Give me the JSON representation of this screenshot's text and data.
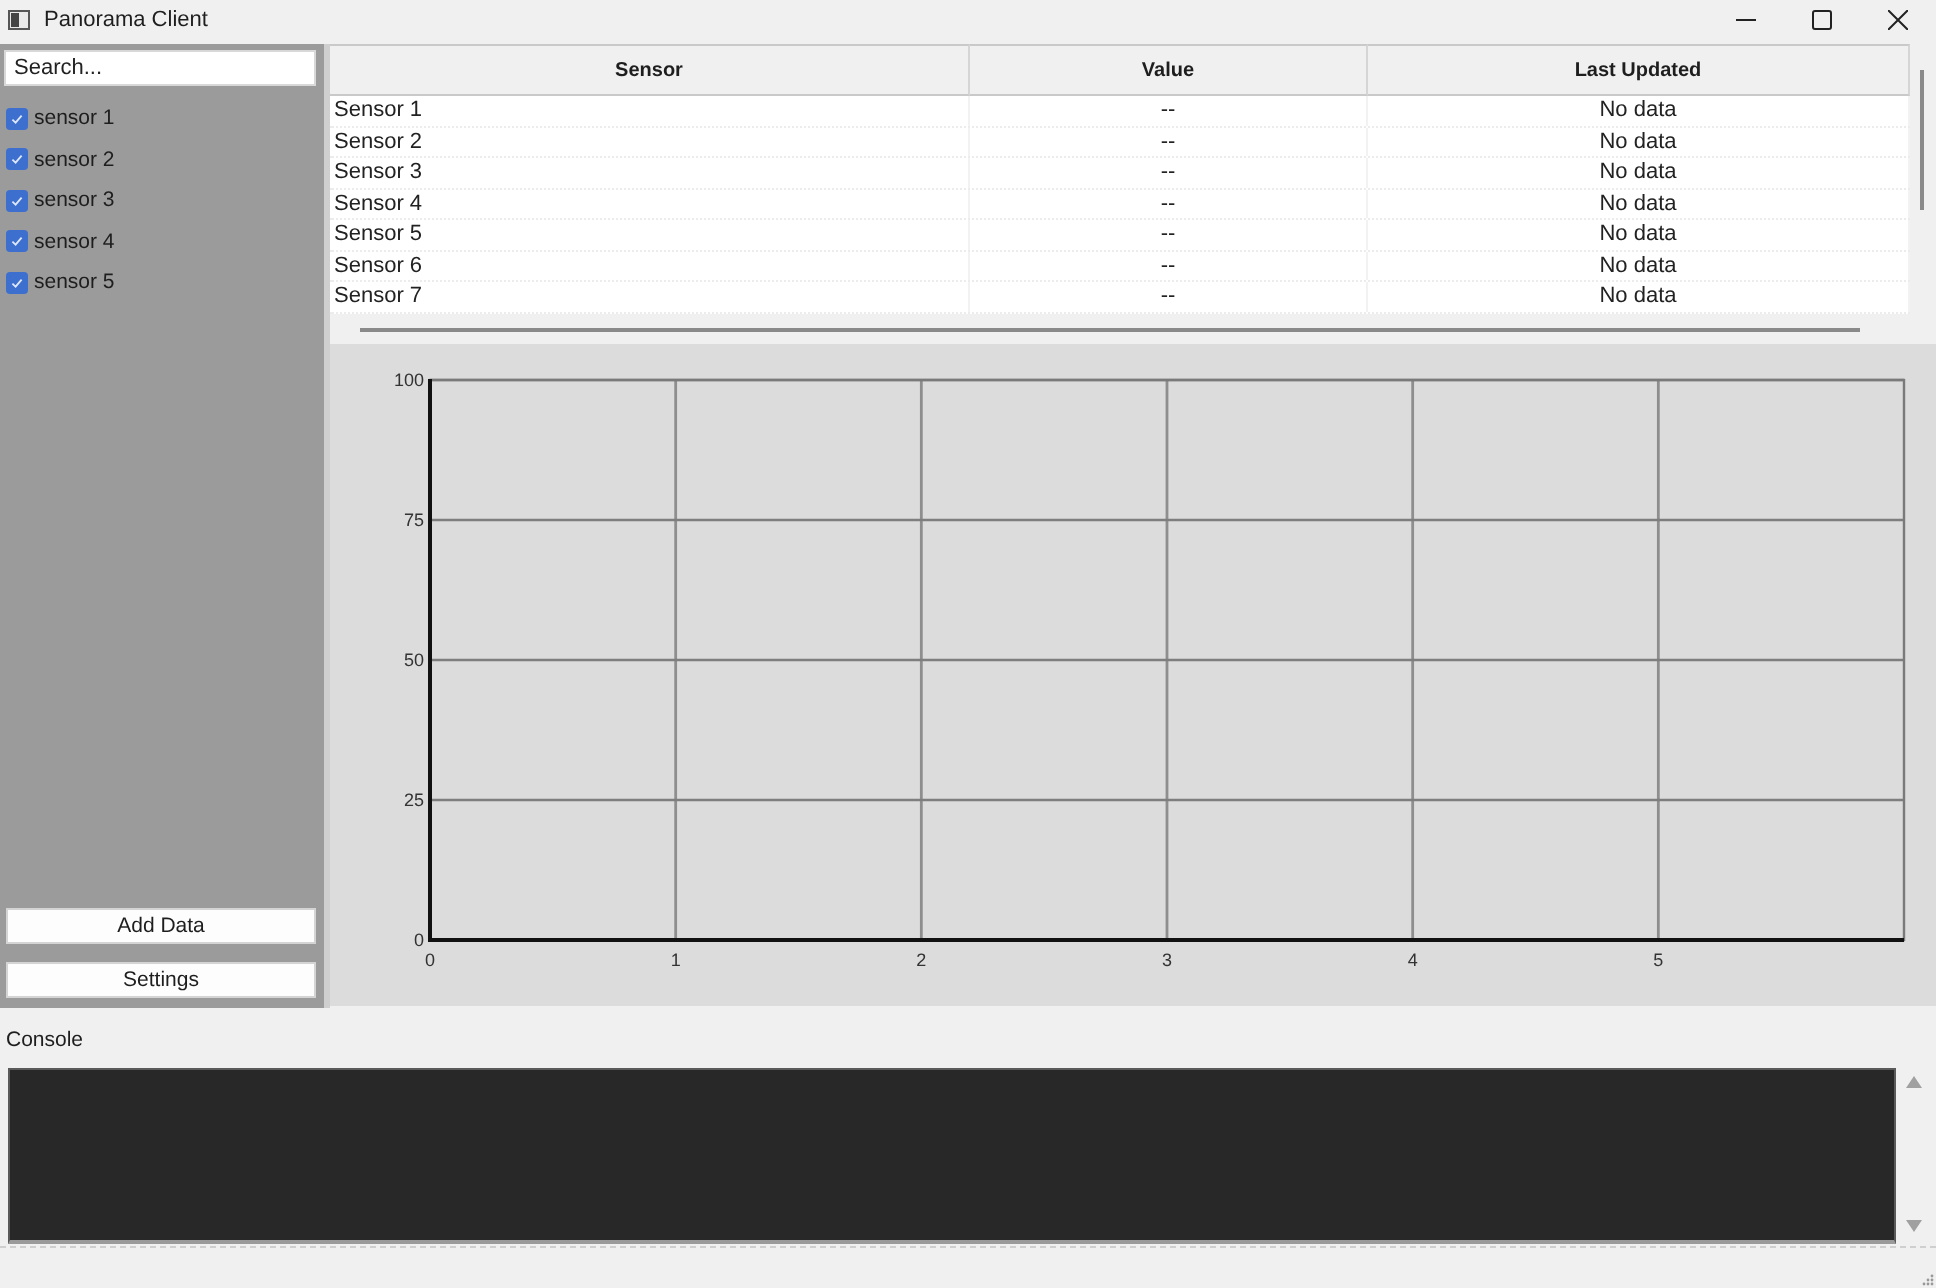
{
  "window": {
    "title": "Panorama Client"
  },
  "sidebar": {
    "search": {
      "placeholder": "Search..."
    },
    "items": [
      {
        "label": "sensor 1",
        "checked": true
      },
      {
        "label": "sensor 2",
        "checked": true
      },
      {
        "label": "sensor 3",
        "checked": true
      },
      {
        "label": "sensor 4",
        "checked": true
      },
      {
        "label": "sensor 5",
        "checked": true
      }
    ],
    "buttons": [
      "Add Data",
      "Settings"
    ]
  },
  "table": {
    "columns": [
      "Sensor",
      "Value",
      "Last Updated"
    ],
    "rows": [
      [
        "Sensor 1",
        "--",
        "No data"
      ],
      [
        "Sensor 2",
        "--",
        "No data"
      ],
      [
        "Sensor 3",
        "--",
        "No data"
      ],
      [
        "Sensor 4",
        "--",
        "No data"
      ],
      [
        "Sensor 5",
        "--",
        "No data"
      ],
      [
        "Sensor 6",
        "--",
        "No data"
      ],
      [
        "Sensor 7",
        "--",
        "No data"
      ]
    ]
  },
  "chart": {
    "chart_data": {
      "type": "line",
      "xlim": [
        0,
        6
      ],
      "ylim": [
        0,
        100
      ],
      "xticks": [
        0,
        1,
        2,
        3,
        4,
        5
      ],
      "yticks": [
        0,
        25,
        50,
        75,
        100
      ],
      "grid": true
    }
  },
  "console": {
    "label": "Console"
  }
}
